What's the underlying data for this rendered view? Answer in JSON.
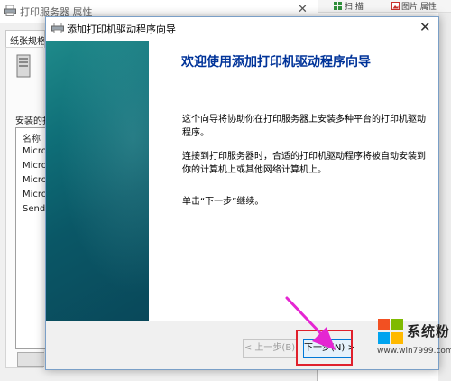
{
  "background_window": {
    "title": "打印服务器 属性",
    "tab_label": "纸张规格",
    "installed_label": "安装的打",
    "list_header": "名称",
    "list_rows": [
      "Micro",
      "Micro",
      "Micro",
      "Micro",
      "Send"
    ]
  },
  "toolbar": {
    "item_1": "扫 描",
    "item_2": "图片 属性"
  },
  "wizard": {
    "title": "添加打印机驱动程序向导",
    "heading": "欢迎使用添加打印机驱动程序向导",
    "paragraph_1": "这个向导将协助你在打印服务器上安装多种平台的打印机驱动程序。",
    "paragraph_2": "连接到打印服务器时，合适的打印机驱动程序将被自动安装到你的计算机上或其他网络计算机上。",
    "paragraph_3": "单击“下一步”继续。",
    "back_button": "< 上一步(B)",
    "next_button": "下一步(N) >"
  },
  "watermark": {
    "name": "系统粉",
    "url": "www.win7999.com"
  },
  "colors": {
    "heading": "#003399",
    "highlight_box": "#e0202c",
    "pointer_arrow": "#e526d2",
    "sidebar_teal": "#0f6f78",
    "next_button_border": "#0078d7"
  },
  "icons": {
    "window_icon": "printer-icon",
    "close": "close-icon",
    "pointer": "arrow-icon",
    "logo": "windows-logo-icon"
  }
}
